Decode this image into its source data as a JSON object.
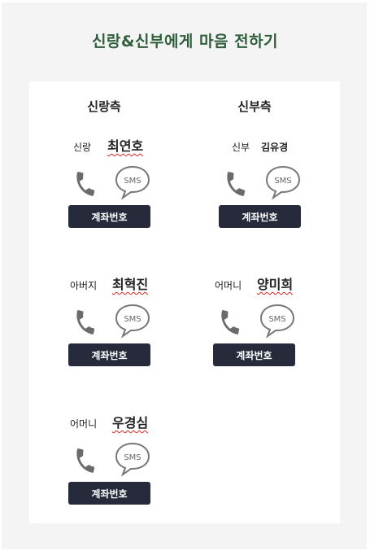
{
  "header": {
    "title": "신랑&신부에게 마음 전하기"
  },
  "groom_side": {
    "heading": "신랑측",
    "people": [
      {
        "role": "신랑",
        "name": "최연호",
        "sms_label": "SMS",
        "account_label": "계좌번호"
      },
      {
        "role": "아버지",
        "name": "최혁진",
        "sms_label": "SMS",
        "account_label": "계좌번호"
      },
      {
        "role": "어머니",
        "name": "우경심",
        "sms_label": "SMS",
        "account_label": "계좌번호"
      }
    ]
  },
  "bride_side": {
    "heading": "신부측",
    "people": [
      {
        "role": "신부",
        "name": "김유경",
        "sms_label": "SMS",
        "account_label": "계좌번호"
      },
      {
        "role": "어머니",
        "name": "양미희",
        "sms_label": "SMS",
        "account_label": "계좌번호"
      }
    ]
  },
  "colors": {
    "title": "#2e5e3a",
    "button_bg": "#262a3a",
    "icon": "#6b6b6b"
  }
}
